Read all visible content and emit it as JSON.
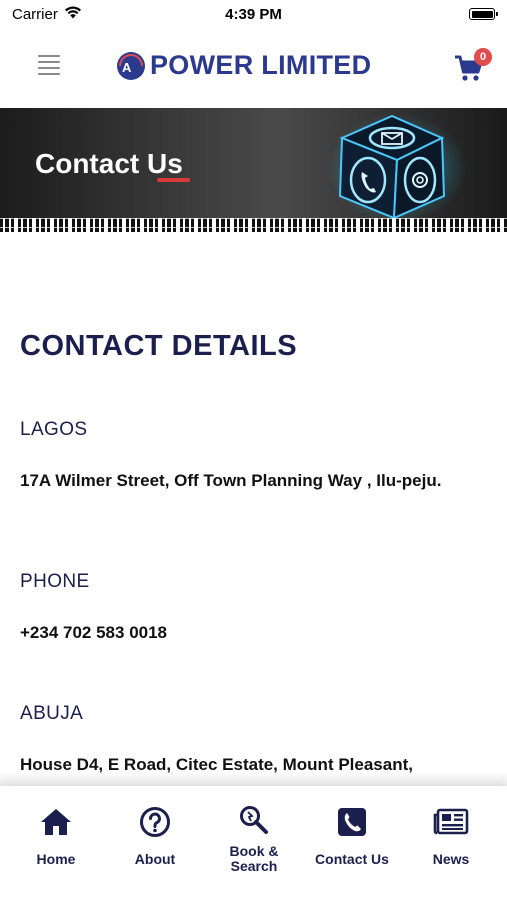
{
  "status_bar": {
    "carrier": "Carrier",
    "time": "4:39 PM"
  },
  "header": {
    "logo_mark": "A",
    "logo_text": "POWER LIMITED",
    "cart_count": "0",
    "brand_color": "#2b3a8f"
  },
  "banner": {
    "title": "Contact Us",
    "accent_color": "#d93a3a"
  },
  "contact": {
    "section_title": "CONTACT DETAILS",
    "lagos_label": "LAGOS",
    "lagos_address": "17A Wilmer Street, Off Town Planning Way , Ilu-peju.",
    "phone_label": "PHONE",
    "phone_number": "+234 702 583 0018",
    "abuja_label": "ABUJA",
    "abuja_address": "House D4, E Road, Citec Estate, Mount Pleasant,"
  },
  "bottom_nav": {
    "items": [
      {
        "label": "Home",
        "icon": "home-icon"
      },
      {
        "label": "About",
        "icon": "question-circle-icon"
      },
      {
        "label": "Book & Search",
        "icon": "search-tool-icon"
      },
      {
        "label": "Contact Us",
        "icon": "phone-icon"
      },
      {
        "label": "News",
        "icon": "newspaper-icon"
      }
    ]
  }
}
